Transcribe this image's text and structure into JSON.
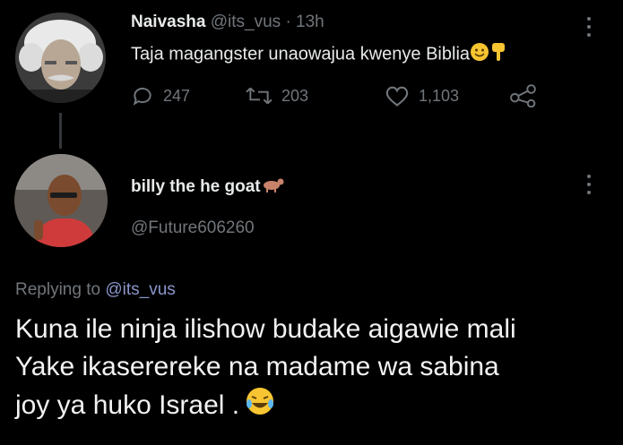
{
  "tweet": {
    "author_name": "Naivasha",
    "author_handle": "@its_vus",
    "separator": "·",
    "time": "13h",
    "text": "Taja magangster unaowajua kwenye Biblia",
    "emoji_icons": [
      "smile-emoji-icon",
      "pointing-down-emoji-icon"
    ],
    "replies": "247",
    "retweets": "203",
    "likes": "1,103"
  },
  "reply": {
    "author_name": "billy the he goat",
    "author_handle": "@Future606260",
    "replying_prefix": "Replying to",
    "replying_to": "@its_vus",
    "text_lines": [
      "Kuna ile ninja ilishow budake aigawie mali",
      "Yake ikaserereke na madame wa sabina",
      "joy ya huko Israel ."
    ],
    "emoji_icon": "laughing-tears-emoji-icon"
  },
  "colors": {
    "background": "#000000",
    "text": "#e7e9ea",
    "muted": "#71767b",
    "link": "#8a95c9"
  }
}
